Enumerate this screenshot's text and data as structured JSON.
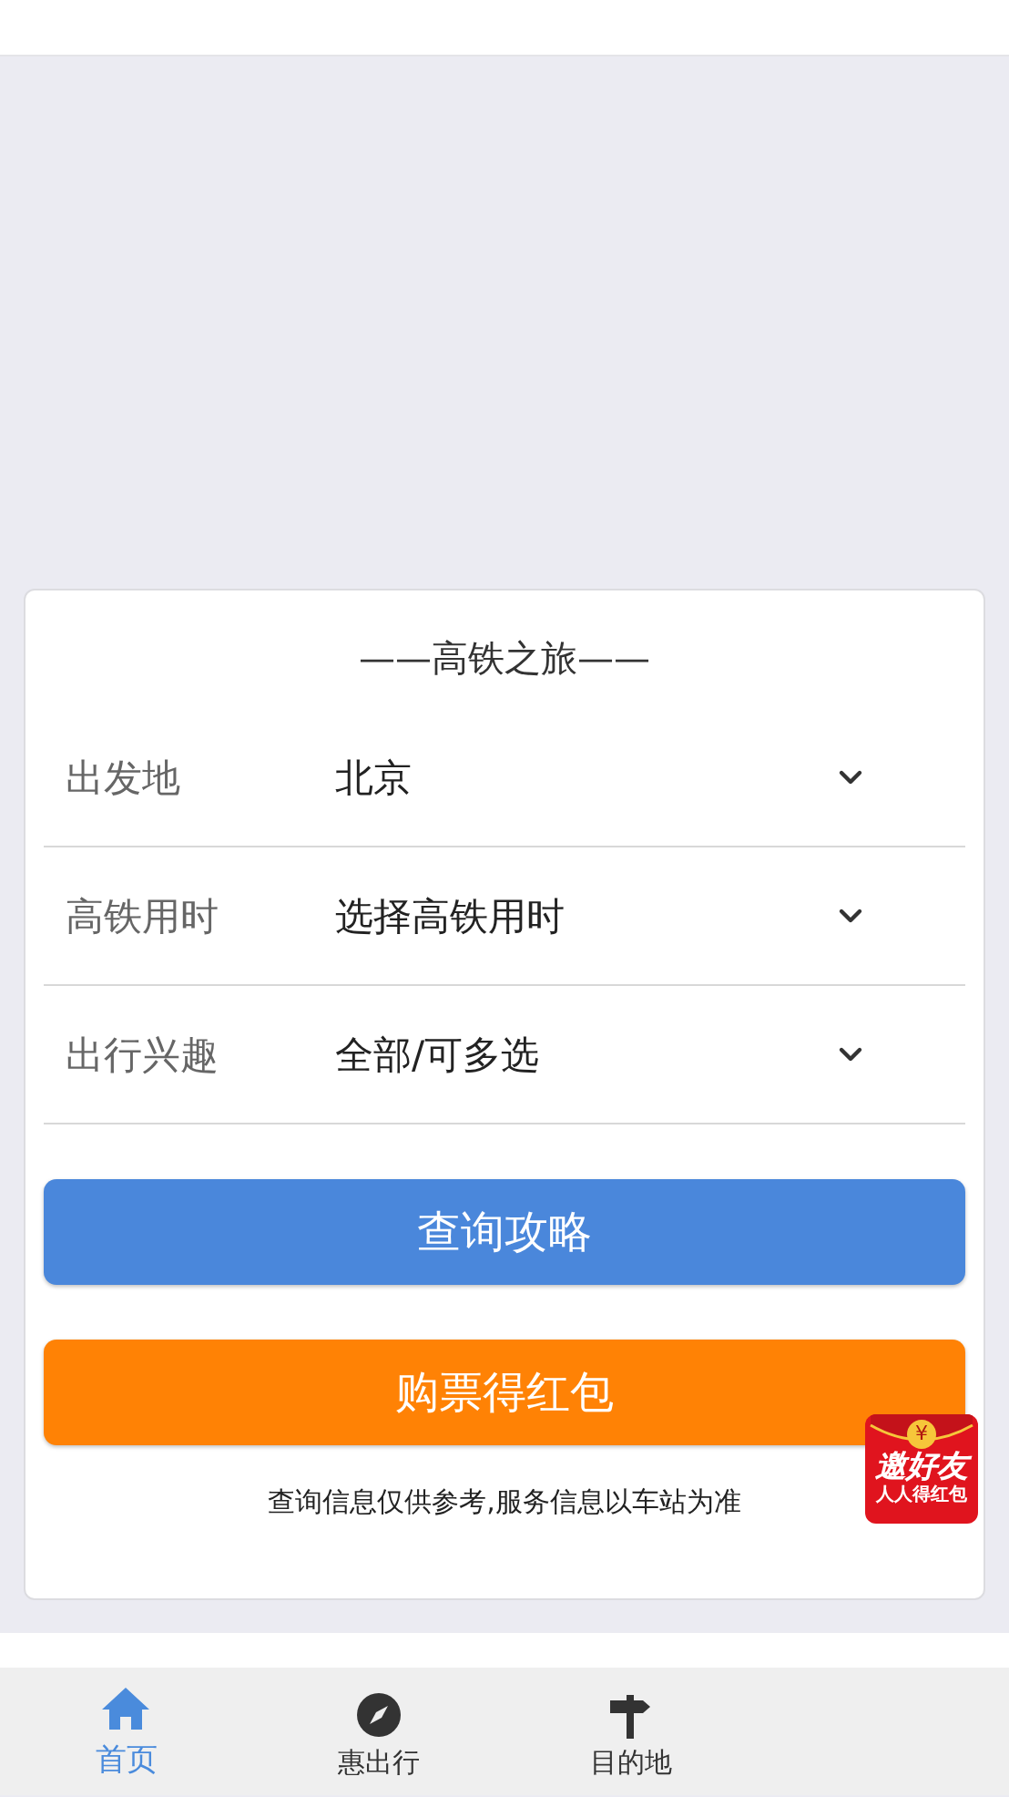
{
  "card": {
    "title": "——高铁之旅——",
    "fields": [
      {
        "label": "出发地",
        "value": "北京"
      },
      {
        "label": "高铁用时",
        "value": "选择高铁用时"
      },
      {
        "label": "出行兴趣",
        "value": "全部/可多选"
      }
    ],
    "buttons": [
      {
        "label": "查询攻略",
        "kind": "primary"
      },
      {
        "label": "购票得红包",
        "kind": "accent"
      }
    ],
    "note": "查询信息仅供参考,服务信息以车站为准"
  },
  "promo_badge": {
    "symbol": "¥",
    "title": "邀好友",
    "subtitle": "人人得红包"
  },
  "tabs": [
    {
      "label": "首页",
      "kind": "home",
      "selected": true
    },
    {
      "label": "惠出行",
      "kind": "compass",
      "selected": false
    },
    {
      "label": "目的地",
      "kind": "signpost",
      "selected": false
    }
  ]
}
